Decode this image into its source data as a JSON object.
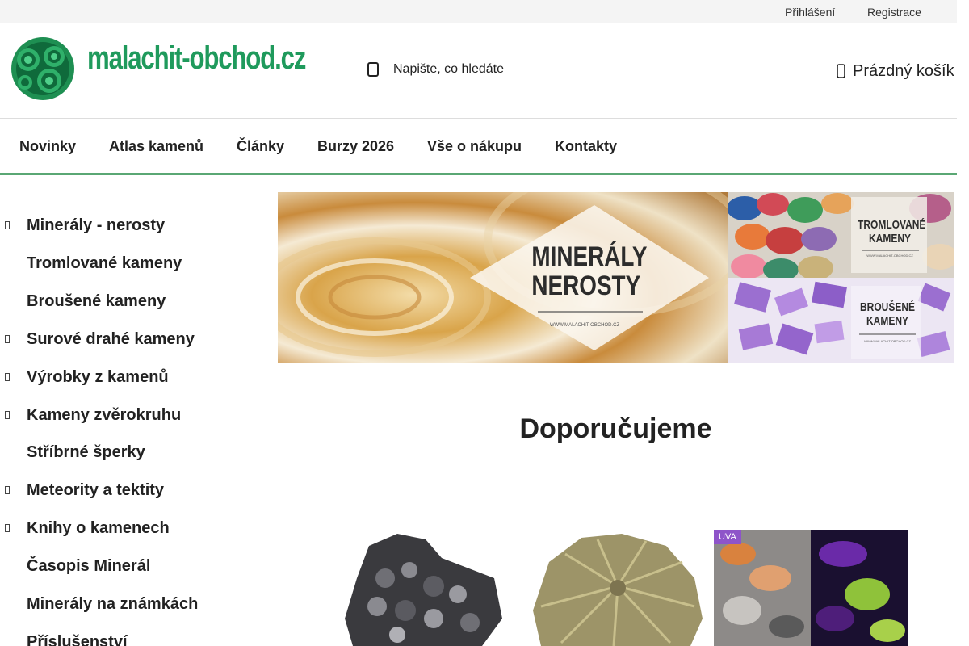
{
  "topbar": {
    "login": "Přihlášení",
    "register": "Registrace"
  },
  "header": {
    "logo_text": "malachit-obchod.cz",
    "search_placeholder": "Napište, co hledáte",
    "cart_label": "Prázdný košík"
  },
  "nav": [
    "Novinky",
    "Atlas kamenů",
    "Články",
    "Burzy 2026",
    "Vše o nákupu",
    "Kontakty"
  ],
  "categories": [
    {
      "label": "Minerály - nerosty",
      "has_sub": true
    },
    {
      "label": "Tromlované kameny",
      "has_sub": false
    },
    {
      "label": "Broušené kameny",
      "has_sub": false
    },
    {
      "label": "Surové drahé kameny",
      "has_sub": true
    },
    {
      "label": "Výrobky z kamenů",
      "has_sub": true
    },
    {
      "label": "Kameny zvěrokruhu",
      "has_sub": true
    },
    {
      "label": "Stříbrné šperky",
      "has_sub": false
    },
    {
      "label": "Meteority a tektity",
      "has_sub": true
    },
    {
      "label": "Knihy o kamenech",
      "has_sub": true
    },
    {
      "label": "Časopis Minerál",
      "has_sub": false
    },
    {
      "label": "Minerály na známkách",
      "has_sub": false
    },
    {
      "label": "Příslušenství",
      "has_sub": false
    }
  ],
  "banners": {
    "main": {
      "title": "MINERÁLY\nNEROSTY",
      "url": "WWW.MALACHIT-OBCHOD.CZ"
    },
    "tumbled": {
      "title": "TROMLOVANÉ\nKAMENY",
      "url": "WWW.MALACHIT-OBCHOD.CZ"
    },
    "cut": {
      "title": "BROUŠENÉ\nKAMENY",
      "url": "WWW.MALACHIT-OBCHOD.CZ"
    }
  },
  "section_title": "Doporučujeme",
  "products": [
    {
      "badge": ""
    },
    {
      "badge": ""
    },
    {
      "badge": "UVA"
    }
  ],
  "colors": {
    "brand_green": "#1f9a5c",
    "nav_border": "#5aa774",
    "badge_purple": "#8e54c9"
  }
}
